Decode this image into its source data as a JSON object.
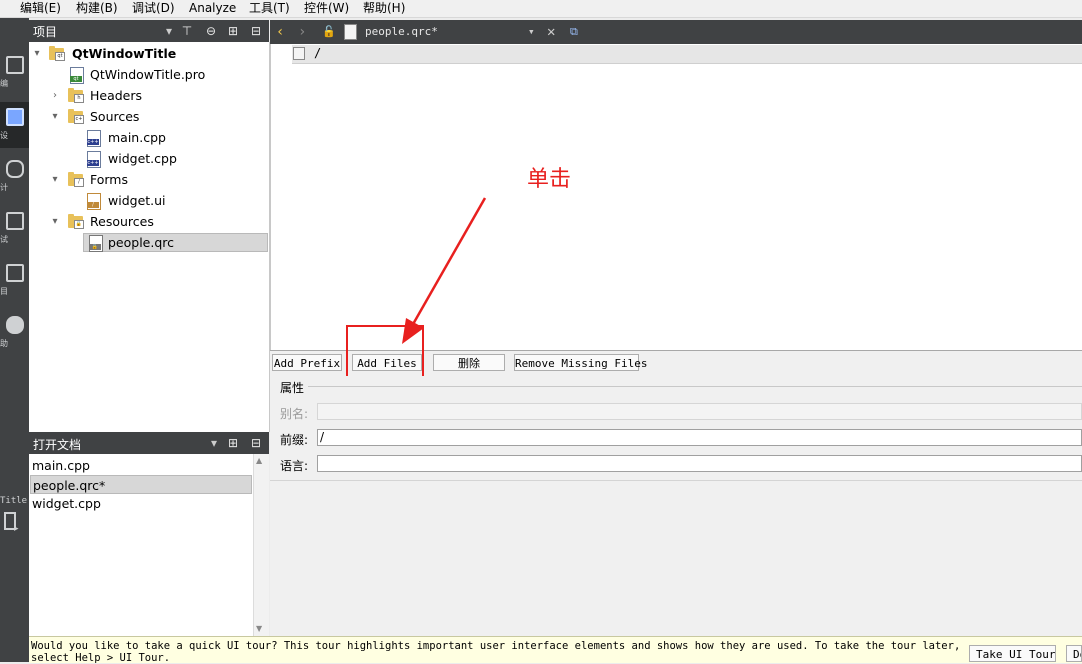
{
  "menu": [
    "编辑(E)",
    "构建(B)",
    "调试(D)",
    "Analyze",
    "工具(T)",
    "控件(W)",
    "帮助(H)"
  ],
  "mode_bar": {
    "labels": [
      "编",
      "设",
      "计",
      "试",
      "目",
      "助"
    ],
    "project_label": "Title"
  },
  "project_pane": {
    "title": "项目",
    "tree": [
      {
        "label": "QtWindowTitle",
        "kind": "project"
      },
      {
        "label": "QtWindowTitle.pro",
        "kind": "pro-file"
      },
      {
        "label": "Headers",
        "kind": "folder",
        "tag": "h"
      },
      {
        "label": "Sources",
        "kind": "folder",
        "tag": "c++"
      },
      {
        "label": "main.cpp",
        "kind": "cpp-file"
      },
      {
        "label": "widget.cpp",
        "kind": "cpp-file"
      },
      {
        "label": "Forms",
        "kind": "folder"
      },
      {
        "label": "widget.ui",
        "kind": "ui-file"
      },
      {
        "label": "Resources",
        "kind": "folder"
      },
      {
        "label": "people.qrc",
        "kind": "qrc-file",
        "selected": true
      }
    ]
  },
  "open_docs": {
    "title": "打开文档",
    "items": [
      {
        "label": "main.cpp"
      },
      {
        "label": "people.qrc*",
        "selected": true
      },
      {
        "label": "widget.cpp"
      }
    ]
  },
  "editor": {
    "document": "people.qrc*",
    "prefix_root": "/"
  },
  "resource_buttons": {
    "add_prefix": "Add Prefix",
    "add_files": "Add Files",
    "remove": "删除",
    "remove_missing": "Remove Missing Files"
  },
  "properties": {
    "title": "属性",
    "alias_label": "别名:",
    "alias_value": "",
    "prefix_label": "前缀:",
    "prefix_value": "/",
    "language_label": "语言:",
    "language_value": ""
  },
  "annotation": {
    "text": "单击",
    "color": "#e8201f"
  },
  "tour_bar": {
    "message": "Would you like to take a quick UI tour? This tour highlights important user interface elements and shows how they are used. To take the tour later, select Help > UI Tour.",
    "take_tour": "Take UI Tour",
    "dismiss": "Do"
  },
  "colors": {
    "dark_panel": "#404244",
    "selection": "#d7d7d7",
    "folder": "#e8c15a"
  }
}
